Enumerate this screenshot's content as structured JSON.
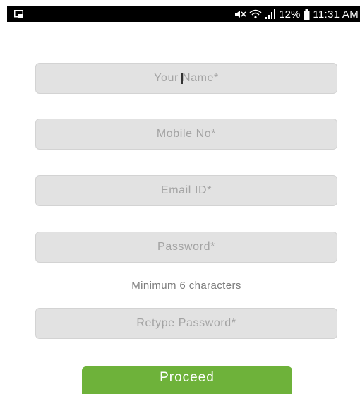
{
  "status_bar": {
    "battery_percent": "12%",
    "time": "11:31 AM",
    "icons": [
      "notification-icon",
      "mute-icon",
      "wifi-icon",
      "signal-icon",
      "battery-icon"
    ]
  },
  "form": {
    "name_field": {
      "value": "",
      "placeholder_before_cursor": "Your ",
      "placeholder_after_cursor": "Name*"
    },
    "mobile_field": {
      "value": "",
      "placeholder": "Mobile No*"
    },
    "email_field": {
      "value": "",
      "placeholder": "Email ID*"
    },
    "password_field": {
      "value": "",
      "placeholder": "Password*"
    },
    "password_hint": "Minimum 6 characters",
    "retype_password_field": {
      "value": "",
      "placeholder": "Retype Password*"
    },
    "proceed_label": "Proceed"
  },
  "colors": {
    "status_bar": "#000000",
    "field_background": "#e2e2e2",
    "placeholder_text": "#a3a3a3",
    "hint_text": "#7b7b7b",
    "accent_button": "#6eb23a",
    "button_text": "#ffffff"
  }
}
